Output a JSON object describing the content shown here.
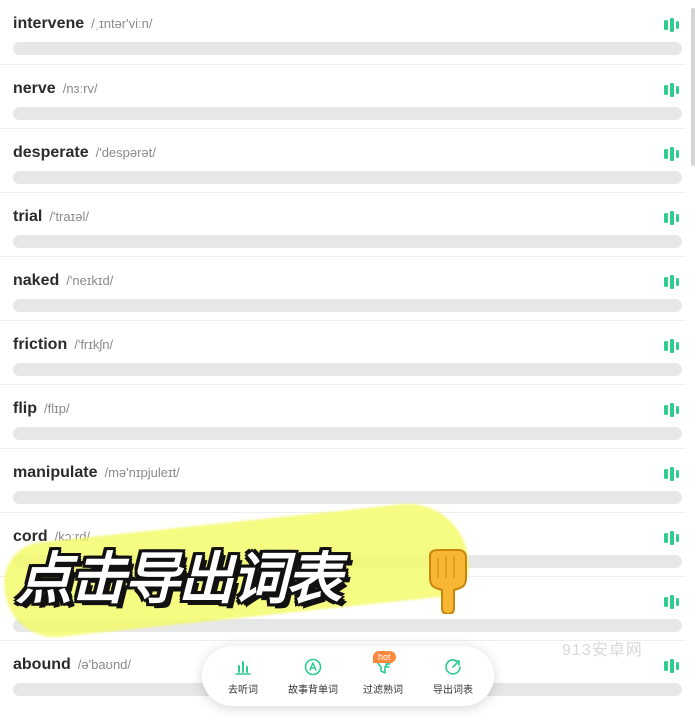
{
  "words": [
    {
      "word": "intervene",
      "phonetic": "/ˌɪntər'viːn/"
    },
    {
      "word": "nerve",
      "phonetic": "/nɜːrv/"
    },
    {
      "word": "desperate",
      "phonetic": "/'despərət/"
    },
    {
      "word": "trial",
      "phonetic": "/'traɪəl/"
    },
    {
      "word": "naked",
      "phonetic": "/'neɪkɪd/"
    },
    {
      "word": "friction",
      "phonetic": "/'frɪkʃn/"
    },
    {
      "word": "flip",
      "phonetic": "/flɪp/"
    },
    {
      "word": "manipulate",
      "phonetic": "/mə'nɪpjuleɪt/"
    },
    {
      "word": "cord",
      "phonetic": "/kɔːrd/"
    },
    {
      "word": "",
      "phonetic": ""
    },
    {
      "word": "abound",
      "phonetic": "/ə'baʊnd/"
    }
  ],
  "overlay": {
    "text": "点击导出词表"
  },
  "watermark": "913安卓网",
  "bottom_bar": {
    "listen": "去听词",
    "story": "故事背单词",
    "filter": "过滤熟词",
    "filter_badge": "hot",
    "export": "导出词表"
  },
  "colors": {
    "accent": "#2ecc8f",
    "badge": "#ff8a3d",
    "highlight": "#f4fa5f"
  }
}
